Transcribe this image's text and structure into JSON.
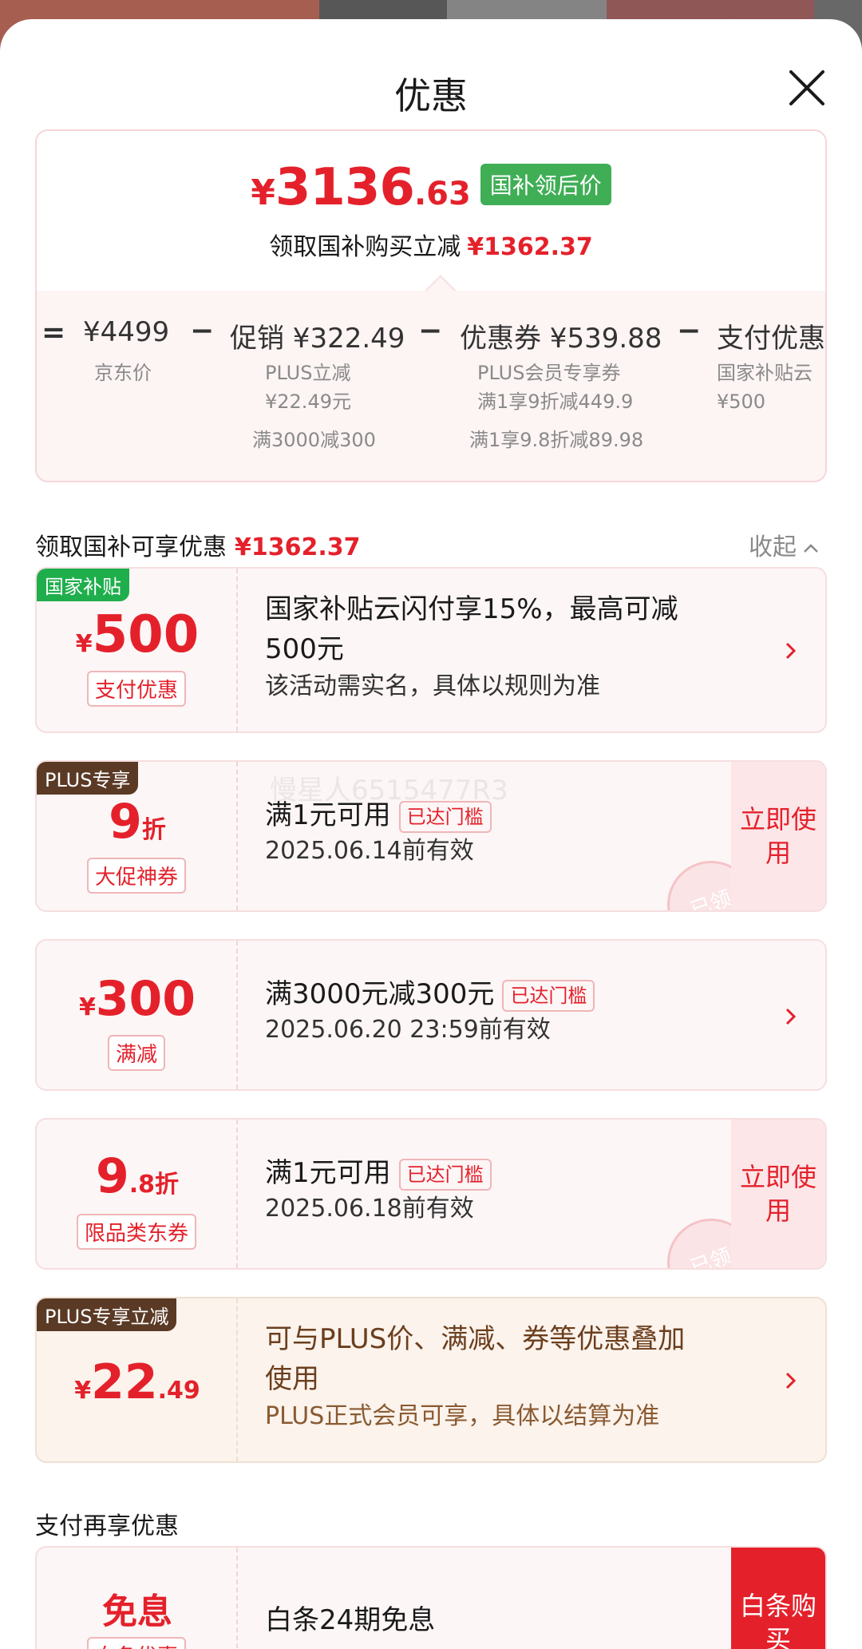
{
  "header": {
    "title": "优惠"
  },
  "summary": {
    "currency": "¥",
    "price_int": "3136",
    "price_dec": ".63",
    "price_tag": "国补领后价",
    "sub_text": "领取国补购买立减",
    "sub_amount": "¥1362.37",
    "calc": {
      "eq": "=",
      "jd_price": "¥4499",
      "jd_label": "京东价",
      "op1": "−",
      "promo": "促销 ¥322.49",
      "promo_note1": "PLUS立减",
      "promo_note2": "¥22.49元",
      "promo_note3": "满3000减300",
      "op2": "−",
      "coupon": "优惠券 ¥539.88",
      "coupon_note1": "PLUS会员专享券",
      "coupon_note2": "满1享9折减449.9",
      "coupon_note3": "满1享9.8折减89.98",
      "op3": "−",
      "pay": "支付优惠",
      "pay_note1": "国家补贴云",
      "pay_note2": "¥500"
    }
  },
  "section": {
    "title": "领取国补可享优惠",
    "amount": "¥1362.37",
    "collapse": "收起"
  },
  "cards": [
    {
      "corner": "国家补贴",
      "currency": "¥",
      "value": "500",
      "pill": "支付优惠",
      "title_l1": "国家补贴云闪付享15%，最高可减",
      "title_l2": "500元",
      "sub": "该活动需实名，具体以规则为准"
    },
    {
      "corner": "PLUS专享",
      "value": "9",
      "unit": "折",
      "pill": "大促神券",
      "title": "满1元可用",
      "badge": "已达门槛",
      "sub": "2025.06.14前有效",
      "action": "立即使用",
      "stamp": "已领",
      "watermark": "慢星人6515477R3"
    },
    {
      "currency": "¥",
      "value": "300",
      "pill": "满减",
      "title": "满3000元减300元",
      "badge": "已达门槛",
      "sub": "2025.06.20 23:59前有效"
    },
    {
      "value": "9",
      "value_dec": ".8",
      "unit": "折",
      "pill": "限品类东券",
      "title": "满1元可用",
      "badge": "已达门槛",
      "sub": "2025.06.18前有效",
      "action": "立即使用",
      "stamp": "已领"
    },
    {
      "corner": "PLUS专享立减",
      "currency": "¥",
      "value": "22",
      "value_dec": ".49",
      "title_l1": "可与PLUS价、满减、券等优惠叠加",
      "title_l2": "使用",
      "sub": "PLUS正式会员可享，具体以结算为准"
    }
  ],
  "section2": {
    "title": "支付再享优惠"
  },
  "baitiao": {
    "value": "免息",
    "pill": "白条优惠",
    "title": "白条24期免息",
    "action": "白条购买"
  },
  "colors": {
    "accent_red": "#e4212b",
    "gov_green": "#3fae55",
    "plus_brown": "#5a3a25"
  }
}
